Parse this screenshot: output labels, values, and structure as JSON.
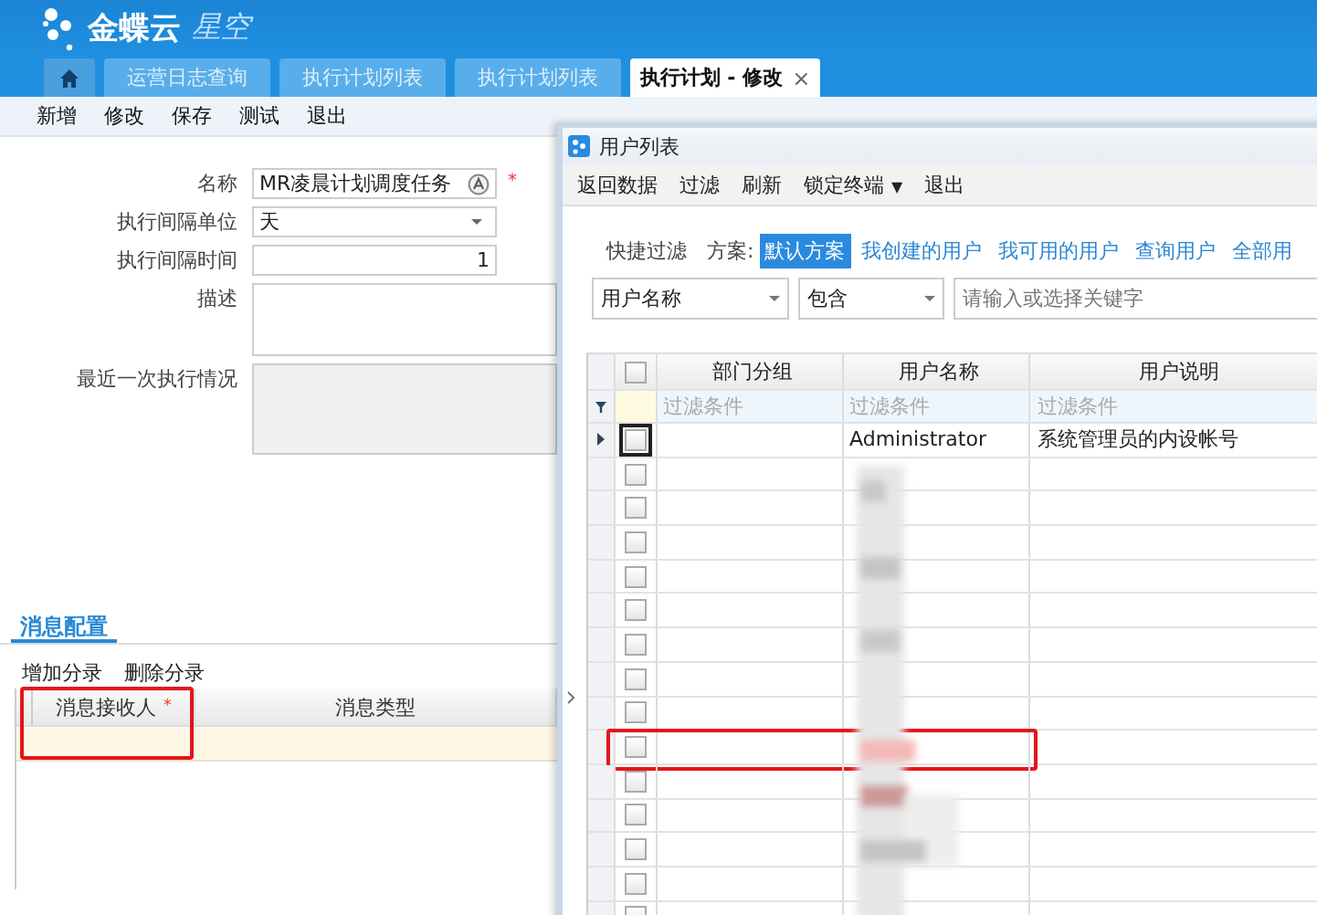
{
  "app": {
    "logo_main": "金蝶云",
    "logo_sub": "星空"
  },
  "tabs": [
    {
      "kind": "home",
      "selected": false
    },
    {
      "kind": "text",
      "label": "运营日志查询",
      "selected": false
    },
    {
      "kind": "text",
      "label": "执行计划列表",
      "selected": false
    },
    {
      "kind": "text",
      "label": "执行计划列表",
      "selected": false
    },
    {
      "kind": "text",
      "label": "执行计划 - 修改",
      "selected": true,
      "close": "×"
    }
  ],
  "toolbar": [
    "新增",
    "修改",
    "保存",
    "测试",
    "退出"
  ],
  "form": {
    "fields": [
      {
        "label": "名称",
        "kind": "lookup",
        "value": "MR凌晨计划调度任务",
        "required_mark": "*"
      },
      {
        "label": "执行间隔单位",
        "kind": "select",
        "value": "天"
      },
      {
        "label": "执行间隔时间",
        "kind": "number",
        "value": "1"
      },
      {
        "label": "描述",
        "kind": "textarea"
      },
      {
        "label": "最近一次执行情况",
        "kind": "readonly"
      }
    ]
  },
  "message_config": {
    "tab": {
      "label": "消息配置",
      "selected": true
    },
    "actions": [
      "增加分录",
      "删除分录"
    ],
    "columns": [
      {
        "label": "消息接收人",
        "required_mark": "*",
        "highlighted": true
      },
      {
        "label": "消息类型",
        "highlighted": false
      }
    ]
  },
  "dialog": {
    "title": "用户列表",
    "toolbar": [
      {
        "label": "返回数据"
      },
      {
        "label": "过滤"
      },
      {
        "label": "刷新"
      },
      {
        "label": "锁定终端",
        "caret": "▼"
      },
      {
        "label": "退出"
      }
    ],
    "quick_filter": {
      "label": "快捷过滤",
      "scheme_label": "方案:",
      "schemes": [
        {
          "label": "默认方案",
          "selected": true
        },
        {
          "label": "我创建的用户",
          "selected": false
        },
        {
          "label": "我可用的用户",
          "selected": false
        },
        {
          "label": "查询用户",
          "selected": false
        },
        {
          "label": "全部用",
          "selected": false
        }
      ]
    },
    "search": {
      "field": "用户名称",
      "operator": "包含",
      "placeholder": "请输入或选择关键字"
    },
    "select_all": {
      "checked": false
    },
    "columns": [
      "部门分组",
      "用户名称",
      "用户说明"
    ],
    "filter_hint": [
      "过滤条件",
      "过滤条件",
      "过滤条件"
    ],
    "rows": [
      {
        "name": "Administrator",
        "description": "系统管理员的内设帐号",
        "checked": false,
        "current": true,
        "highlighted": false
      },
      {
        "checked": false,
        "current": false,
        "highlighted": false
      },
      {
        "checked": false,
        "current": false,
        "highlighted": false
      },
      {
        "checked": false,
        "current": false,
        "highlighted": false
      },
      {
        "checked": false,
        "current": false,
        "highlighted": false
      },
      {
        "checked": false,
        "current": false,
        "highlighted": false
      },
      {
        "checked": false,
        "current": false,
        "highlighted": false
      },
      {
        "checked": false,
        "current": false,
        "highlighted": false
      },
      {
        "checked": false,
        "current": false,
        "highlighted": false
      },
      {
        "checked": false,
        "current": false,
        "highlighted": true
      },
      {
        "checked": false,
        "current": false,
        "highlighted": false
      },
      {
        "checked": false,
        "current": false,
        "highlighted": false
      },
      {
        "checked": false,
        "current": false,
        "highlighted": false
      },
      {
        "checked": false,
        "current": false,
        "highlighted": false
      },
      {
        "checked": false,
        "current": false,
        "highlighted": false
      }
    ]
  }
}
